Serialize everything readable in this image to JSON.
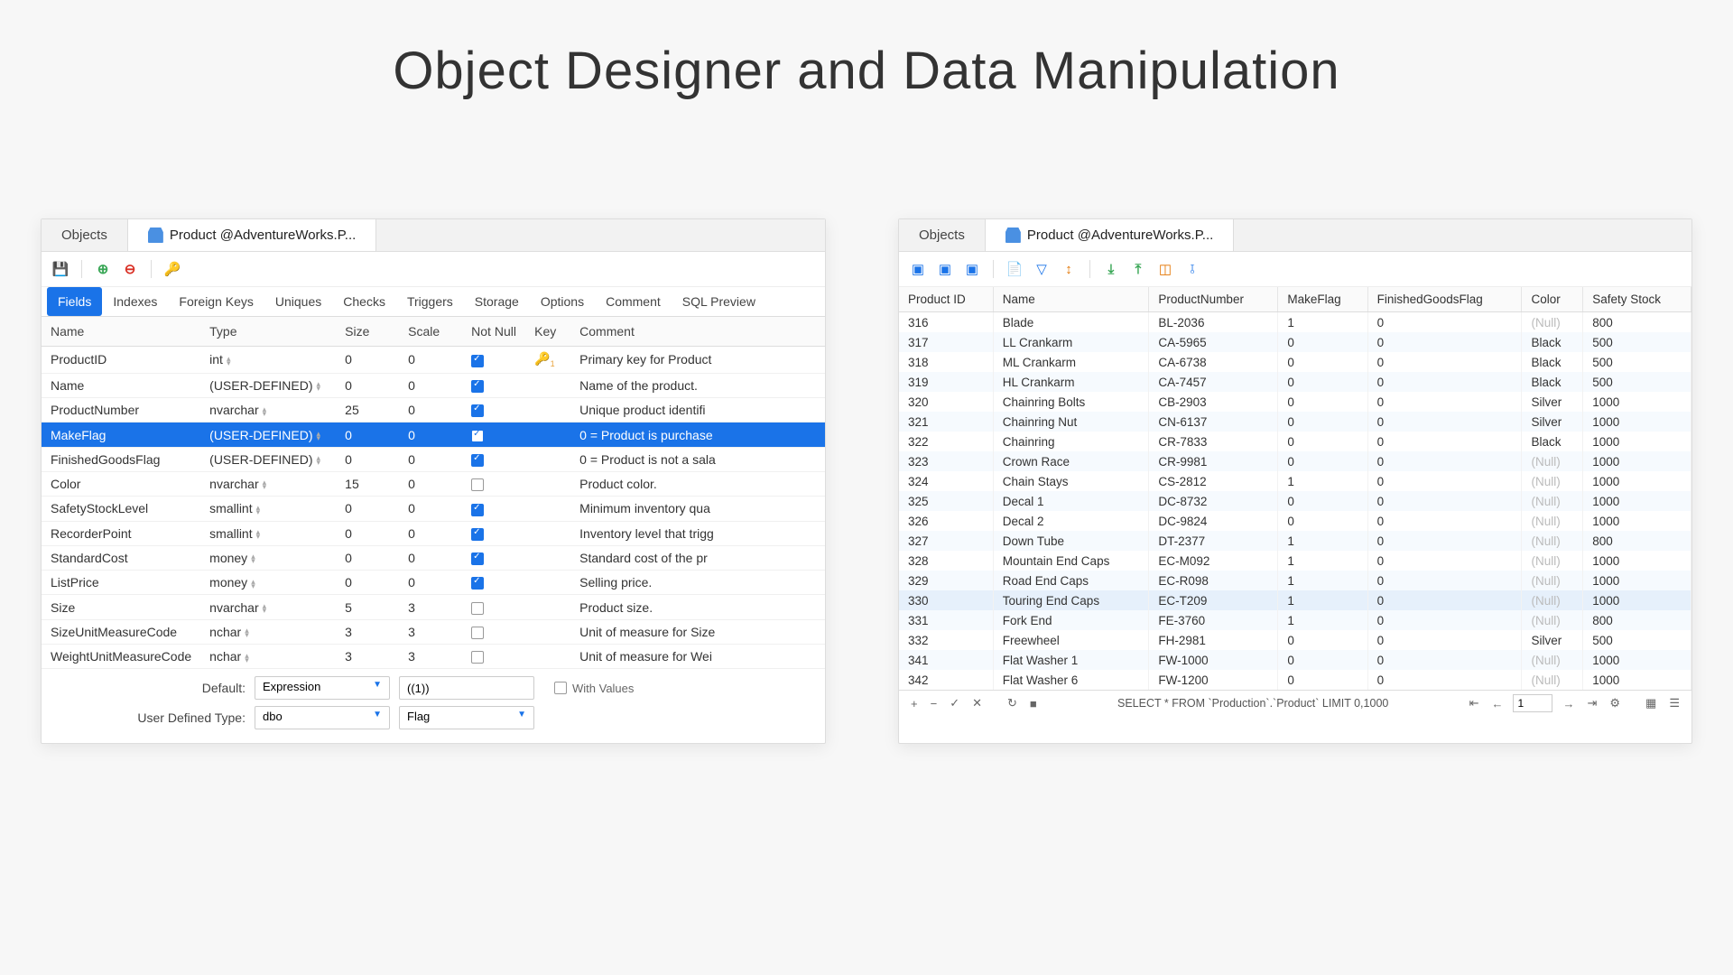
{
  "title": "Object Designer and Data Manipulation",
  "designer": {
    "tabs": {
      "objects": "Objects",
      "active": "Product @AdventureWorks.P..."
    },
    "subtabs": [
      "Fields",
      "Indexes",
      "Foreign Keys",
      "Uniques",
      "Checks",
      "Triggers",
      "Storage",
      "Options",
      "Comment",
      "SQL Preview"
    ],
    "subtab_active": 0,
    "headers": {
      "name": "Name",
      "type": "Type",
      "size": "Size",
      "scale": "Scale",
      "not_null": "Not Null",
      "key": "Key",
      "comment": "Comment"
    },
    "fields": [
      {
        "name": "ProductID",
        "type": "int",
        "size": "0",
        "scale": "0",
        "nn": true,
        "key": true,
        "keylabel": "1",
        "comment": "Primary key for Product"
      },
      {
        "name": "Name",
        "type": "(USER-DEFINED)",
        "size": "0",
        "scale": "0",
        "nn": true,
        "comment": "Name of the product."
      },
      {
        "name": "ProductNumber",
        "type": "nvarchar",
        "size": "25",
        "scale": "0",
        "nn": true,
        "comment": "Unique product identifi"
      },
      {
        "name": "MakeFlag",
        "type": "(USER-DEFINED)",
        "size": "0",
        "scale": "0",
        "nn": true,
        "selected": true,
        "comment": "0 = Product is purchase"
      },
      {
        "name": "FinishedGoodsFlag",
        "type": "(USER-DEFINED)",
        "size": "0",
        "scale": "0",
        "nn": true,
        "comment": "0 = Product is not a sala"
      },
      {
        "name": "Color",
        "type": "nvarchar",
        "size": "15",
        "scale": "0",
        "nn": false,
        "comment": "Product color."
      },
      {
        "name": "SafetyStockLevel",
        "type": "smallint",
        "size": "0",
        "scale": "0",
        "nn": true,
        "comment": "Minimum inventory qua"
      },
      {
        "name": "RecorderPoint",
        "type": "smallint",
        "size": "0",
        "scale": "0",
        "nn": true,
        "comment": "Inventory level that trigg"
      },
      {
        "name": "StandardCost",
        "type": "money",
        "size": "0",
        "scale": "0",
        "nn": true,
        "comment": "Standard cost of the pr"
      },
      {
        "name": "ListPrice",
        "type": "money",
        "size": "0",
        "scale": "0",
        "nn": true,
        "comment": "Selling price."
      },
      {
        "name": "Size",
        "type": "nvarchar",
        "size": "5",
        "scale": "3",
        "nn": false,
        "comment": "Product size."
      },
      {
        "name": "SizeUnitMeasureCode",
        "type": "nchar",
        "size": "3",
        "scale": "3",
        "nn": false,
        "comment": "Unit of measure for Size"
      },
      {
        "name": "WeightUnitMeasureCode",
        "type": "nchar",
        "size": "3",
        "scale": "3",
        "nn": false,
        "comment": "Unit of measure for Wei"
      }
    ],
    "form": {
      "default_label": "Default:",
      "default_sel": "Expression",
      "default_val": "((1))",
      "with_values": "With Values",
      "udt_label": "User Defined Type:",
      "udt_schema": "dbo",
      "udt_type": "Flag"
    }
  },
  "grid": {
    "tabs": {
      "objects": "Objects",
      "active": "Product @AdventureWorks.P..."
    },
    "columns": [
      "Product ID",
      "Name",
      "ProductNumber",
      "MakeFlag",
      "FinishedGoodsFlag",
      "Color",
      "Safety Stock"
    ],
    "rows": [
      {
        "id": "316",
        "name": "Blade",
        "num": "BL-2036",
        "make": "1",
        "fg": "0",
        "color": null,
        "ss": "800"
      },
      {
        "id": "317",
        "name": "LL Crankarm",
        "num": "CA-5965",
        "make": "0",
        "fg": "0",
        "color": "Black",
        "ss": "500"
      },
      {
        "id": "318",
        "name": "ML Crankarm",
        "num": "CA-6738",
        "make": "0",
        "fg": "0",
        "color": "Black",
        "ss": "500"
      },
      {
        "id": "319",
        "name": "HL Crankarm",
        "num": "CA-7457",
        "make": "0",
        "fg": "0",
        "color": "Black",
        "ss": "500"
      },
      {
        "id": "320",
        "name": "Chainring Bolts",
        "num": "CB-2903",
        "make": "0",
        "fg": "0",
        "color": "Silver",
        "ss": "1000"
      },
      {
        "id": "321",
        "name": "Chainring Nut",
        "num": "CN-6137",
        "make": "0",
        "fg": "0",
        "color": "Silver",
        "ss": "1000"
      },
      {
        "id": "322",
        "name": "Chainring",
        "num": "CR-7833",
        "make": "0",
        "fg": "0",
        "color": "Black",
        "ss": "1000"
      },
      {
        "id": "323",
        "name": "Crown Race",
        "num": "CR-9981",
        "make": "0",
        "fg": "0",
        "color": null,
        "ss": "1000"
      },
      {
        "id": "324",
        "name": "Chain Stays",
        "num": "CS-2812",
        "make": "1",
        "fg": "0",
        "color": null,
        "ss": "1000"
      },
      {
        "id": "325",
        "name": "Decal 1",
        "num": "DC-8732",
        "make": "0",
        "fg": "0",
        "color": null,
        "ss": "1000"
      },
      {
        "id": "326",
        "name": "Decal 2",
        "num": "DC-9824",
        "make": "0",
        "fg": "0",
        "color": null,
        "ss": "1000"
      },
      {
        "id": "327",
        "name": "Down Tube",
        "num": "DT-2377",
        "make": "1",
        "fg": "0",
        "color": null,
        "ss": "800"
      },
      {
        "id": "328",
        "name": "Mountain End Caps",
        "num": "EC-M092",
        "make": "1",
        "fg": "0",
        "color": null,
        "ss": "1000"
      },
      {
        "id": "329",
        "name": "Road End Caps",
        "num": "EC-R098",
        "make": "1",
        "fg": "0",
        "color": null,
        "ss": "1000"
      },
      {
        "id": "330",
        "name": "Touring End Caps",
        "num": "EC-T209",
        "make": "1",
        "fg": "0",
        "color": null,
        "ss": "1000",
        "hl": true
      },
      {
        "id": "331",
        "name": "Fork End",
        "num": "FE-3760",
        "make": "1",
        "fg": "0",
        "color": null,
        "ss": "800"
      },
      {
        "id": "332",
        "name": "Freewheel",
        "num": "FH-2981",
        "make": "0",
        "fg": "0",
        "color": "Silver",
        "ss": "500"
      },
      {
        "id": "341",
        "name": "Flat Washer 1",
        "num": "FW-1000",
        "make": "0",
        "fg": "0",
        "color": null,
        "ss": "1000"
      },
      {
        "id": "342",
        "name": "Flat Washer 6",
        "num": "FW-1200",
        "make": "0",
        "fg": "0",
        "color": null,
        "ss": "1000"
      }
    ],
    "status": {
      "sql": "SELECT * FROM `Production`.`Product` LIMIT 0,1000",
      "page": "1"
    }
  }
}
